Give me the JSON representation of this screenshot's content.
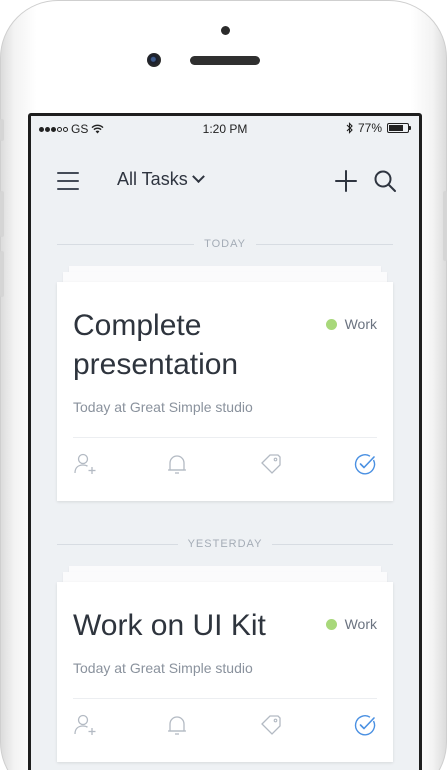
{
  "status_bar": {
    "carrier": "GS",
    "time": "1:20 PM",
    "battery": "77%",
    "battery_level": 0.77,
    "icons": [
      "signal-dots-icon",
      "wifi-icon",
      "bluetooth-icon",
      "battery-icon"
    ]
  },
  "nav": {
    "title": "All Tasks",
    "icons": [
      "menu-icon",
      "chevron-down-icon",
      "plus-icon",
      "search-icon"
    ]
  },
  "sections": [
    {
      "label": "TODAY",
      "card": {
        "title": "Complete presentation",
        "tag": "Work",
        "tag_color": "#a8d87a",
        "subtitle": "Today at Great Simple studio",
        "actions": [
          "add-person-icon",
          "bell-icon",
          "tag-icon",
          "check-circle-icon"
        ]
      }
    },
    {
      "label": "YESTERDAY",
      "card": {
        "title": "Work on UI Kit",
        "tag": "Work",
        "tag_color": "#a8d87a",
        "subtitle": "Today at Great Simple studio",
        "actions": [
          "add-person-icon",
          "bell-icon",
          "tag-icon",
          "check-circle-icon"
        ]
      }
    }
  ],
  "colors": {
    "accent": "#4a90e2",
    "icon_gray": "#b3bac3",
    "background": "#eef1f4"
  }
}
